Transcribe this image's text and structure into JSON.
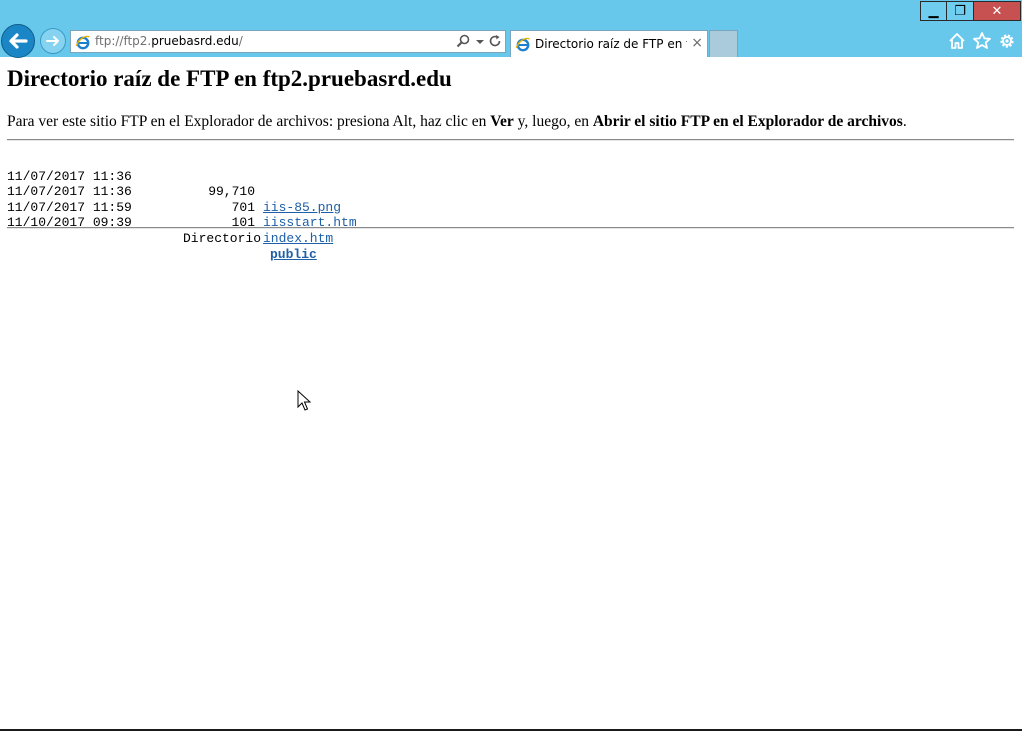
{
  "window": {
    "minimize_glyph": "▁",
    "restore_glyph": "❐",
    "close_glyph": "✕"
  },
  "address_bar": {
    "prefix": "ftp://ftp2.",
    "domain": "pruebasrd.edu",
    "suffix": "/"
  },
  "tab": {
    "title": "Directorio raíz de FTP en ftp...",
    "close_glyph": "×"
  },
  "page": {
    "heading": "Directorio raíz de FTP en ftp2.pruebasrd.edu",
    "instructions": {
      "part1": "Para ver este sitio FTP en el Explorador de archivos: presiona Alt, haz clic en ",
      "bold1": "Ver",
      "part2": " y, luego, en ",
      "bold2": "Abrir el sitio FTP en el Explorador de archivos",
      "part3": "."
    },
    "entries": [
      {
        "datetime": "11/07/2017 11:36",
        "size": "99,710",
        "name": "iis-85.png"
      },
      {
        "datetime": "11/07/2017 11:36",
        "size": "701",
        "name": "iisstart.htm"
      },
      {
        "datetime": "11/07/2017 11:59",
        "size": "101",
        "name": "index.htm"
      }
    ],
    "directory": {
      "datetime": "11/10/2017 09:39",
      "label": "Directorio",
      "name": "public"
    }
  },
  "colors": {
    "chrome": "#68c8ec",
    "link": "#1d5fa8",
    "close_button": "#c75050"
  }
}
